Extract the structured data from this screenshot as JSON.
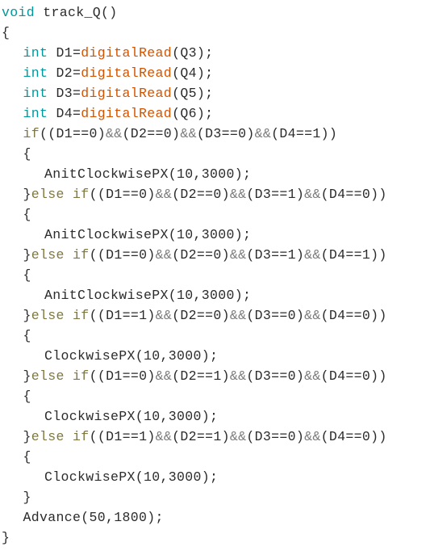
{
  "editor": {
    "language": "arduino-c",
    "background_color": "#ffffff",
    "theme_colors": {
      "keyword": "#00979c",
      "function": "#d35400",
      "control": "#7e7840",
      "operator": "#7d7d7d",
      "plain": "#2b2b2b"
    },
    "function_name": "track_Q",
    "lines": [
      {
        "indent": 0,
        "tokens": [
          {
            "t": "void",
            "c": "keyword"
          },
          {
            "t": " track_Q()",
            "c": "plain"
          }
        ]
      },
      {
        "indent": 0,
        "tokens": [
          {
            "t": "{",
            "c": "plain"
          }
        ]
      },
      {
        "indent": 1,
        "tokens": [
          {
            "t": "int",
            "c": "keyword"
          },
          {
            "t": " D1=",
            "c": "plain"
          },
          {
            "t": "digitalRead",
            "c": "function"
          },
          {
            "t": "(Q3);",
            "c": "plain"
          }
        ]
      },
      {
        "indent": 1,
        "tokens": [
          {
            "t": "int",
            "c": "keyword"
          },
          {
            "t": " D2=",
            "c": "plain"
          },
          {
            "t": "digitalRead",
            "c": "function"
          },
          {
            "t": "(Q4);",
            "c": "plain"
          }
        ]
      },
      {
        "indent": 1,
        "tokens": [
          {
            "t": "int",
            "c": "keyword"
          },
          {
            "t": " D3=",
            "c": "plain"
          },
          {
            "t": "digitalRead",
            "c": "function"
          },
          {
            "t": "(Q5);",
            "c": "plain"
          }
        ]
      },
      {
        "indent": 1,
        "tokens": [
          {
            "t": "int",
            "c": "keyword"
          },
          {
            "t": " D4=",
            "c": "plain"
          },
          {
            "t": "digitalRead",
            "c": "function"
          },
          {
            "t": "(Q6);",
            "c": "plain"
          }
        ]
      },
      {
        "indent": 1,
        "tokens": [
          {
            "t": "if",
            "c": "control"
          },
          {
            "t": "((D1==0)",
            "c": "plain"
          },
          {
            "t": "&&",
            "c": "operator"
          },
          {
            "t": "(D2==0)",
            "c": "plain"
          },
          {
            "t": "&&",
            "c": "operator"
          },
          {
            "t": "(D3==0)",
            "c": "plain"
          },
          {
            "t": "&&",
            "c": "operator"
          },
          {
            "t": "(D4==1))",
            "c": "plain"
          }
        ]
      },
      {
        "indent": 1,
        "tokens": [
          {
            "t": "{",
            "c": "plain"
          }
        ]
      },
      {
        "indent": 2,
        "tokens": [
          {
            "t": "AnitClockwisePX(10,3000);",
            "c": "plain"
          }
        ]
      },
      {
        "indent": 1,
        "tokens": [
          {
            "t": "}",
            "c": "plain"
          },
          {
            "t": "else",
            "c": "control"
          },
          {
            "t": " ",
            "c": "plain"
          },
          {
            "t": "if",
            "c": "control"
          },
          {
            "t": "((D1==0)",
            "c": "plain"
          },
          {
            "t": "&&",
            "c": "operator"
          },
          {
            "t": "(D2==0)",
            "c": "plain"
          },
          {
            "t": "&&",
            "c": "operator"
          },
          {
            "t": "(D3==1)",
            "c": "plain"
          },
          {
            "t": "&&",
            "c": "operator"
          },
          {
            "t": "(D4==0))",
            "c": "plain"
          }
        ]
      },
      {
        "indent": 1,
        "tokens": [
          {
            "t": "{",
            "c": "plain"
          }
        ]
      },
      {
        "indent": 2,
        "tokens": [
          {
            "t": "AnitClockwisePX(10,3000);",
            "c": "plain"
          }
        ]
      },
      {
        "indent": 1,
        "tokens": [
          {
            "t": "}",
            "c": "plain"
          },
          {
            "t": "else",
            "c": "control"
          },
          {
            "t": " ",
            "c": "plain"
          },
          {
            "t": "if",
            "c": "control"
          },
          {
            "t": "((D1==0)",
            "c": "plain"
          },
          {
            "t": "&&",
            "c": "operator"
          },
          {
            "t": "(D2==0)",
            "c": "plain"
          },
          {
            "t": "&&",
            "c": "operator"
          },
          {
            "t": "(D3==1)",
            "c": "plain"
          },
          {
            "t": "&&",
            "c": "operator"
          },
          {
            "t": "(D4==1))",
            "c": "plain"
          }
        ]
      },
      {
        "indent": 1,
        "tokens": [
          {
            "t": "{",
            "c": "plain"
          }
        ]
      },
      {
        "indent": 2,
        "tokens": [
          {
            "t": "AnitClockwisePX(10,3000);",
            "c": "plain"
          }
        ]
      },
      {
        "indent": 1,
        "tokens": [
          {
            "t": "}",
            "c": "plain"
          },
          {
            "t": "else",
            "c": "control"
          },
          {
            "t": " ",
            "c": "plain"
          },
          {
            "t": "if",
            "c": "control"
          },
          {
            "t": "((D1==1)",
            "c": "plain"
          },
          {
            "t": "&&",
            "c": "operator"
          },
          {
            "t": "(D2==0)",
            "c": "plain"
          },
          {
            "t": "&&",
            "c": "operator"
          },
          {
            "t": "(D3==0)",
            "c": "plain"
          },
          {
            "t": "&&",
            "c": "operator"
          },
          {
            "t": "(D4==0))",
            "c": "plain"
          }
        ]
      },
      {
        "indent": 1,
        "tokens": [
          {
            "t": "{",
            "c": "plain"
          }
        ]
      },
      {
        "indent": 2,
        "tokens": [
          {
            "t": "ClockwisePX(10,3000);",
            "c": "plain"
          }
        ]
      },
      {
        "indent": 1,
        "tokens": [
          {
            "t": "}",
            "c": "plain"
          },
          {
            "t": "else",
            "c": "control"
          },
          {
            "t": " ",
            "c": "plain"
          },
          {
            "t": "if",
            "c": "control"
          },
          {
            "t": "((D1==0)",
            "c": "plain"
          },
          {
            "t": "&&",
            "c": "operator"
          },
          {
            "t": "(D2==1)",
            "c": "plain"
          },
          {
            "t": "&&",
            "c": "operator"
          },
          {
            "t": "(D3==0)",
            "c": "plain"
          },
          {
            "t": "&&",
            "c": "operator"
          },
          {
            "t": "(D4==0))",
            "c": "plain"
          }
        ]
      },
      {
        "indent": 1,
        "tokens": [
          {
            "t": "{",
            "c": "plain"
          }
        ]
      },
      {
        "indent": 2,
        "tokens": [
          {
            "t": "ClockwisePX(10,3000);",
            "c": "plain"
          }
        ]
      },
      {
        "indent": 1,
        "tokens": [
          {
            "t": "}",
            "c": "plain"
          },
          {
            "t": "else",
            "c": "control"
          },
          {
            "t": " ",
            "c": "plain"
          },
          {
            "t": "if",
            "c": "control"
          },
          {
            "t": "((D1==1)",
            "c": "plain"
          },
          {
            "t": "&&",
            "c": "operator"
          },
          {
            "t": "(D2==1)",
            "c": "plain"
          },
          {
            "t": "&&",
            "c": "operator"
          },
          {
            "t": "(D3==0)",
            "c": "plain"
          },
          {
            "t": "&&",
            "c": "operator"
          },
          {
            "t": "(D4==0))",
            "c": "plain"
          }
        ]
      },
      {
        "indent": 1,
        "tokens": [
          {
            "t": "{",
            "c": "plain"
          }
        ]
      },
      {
        "indent": 2,
        "tokens": [
          {
            "t": "ClockwisePX(10,3000);",
            "c": "plain"
          }
        ]
      },
      {
        "indent": 1,
        "tokens": [
          {
            "t": "}",
            "c": "plain"
          }
        ]
      },
      {
        "indent": 1,
        "tokens": [
          {
            "t": "Advance(50,1800);",
            "c": "plain"
          }
        ]
      },
      {
        "indent": 0,
        "tokens": [
          {
            "t": "}",
            "c": "plain"
          }
        ]
      }
    ]
  }
}
